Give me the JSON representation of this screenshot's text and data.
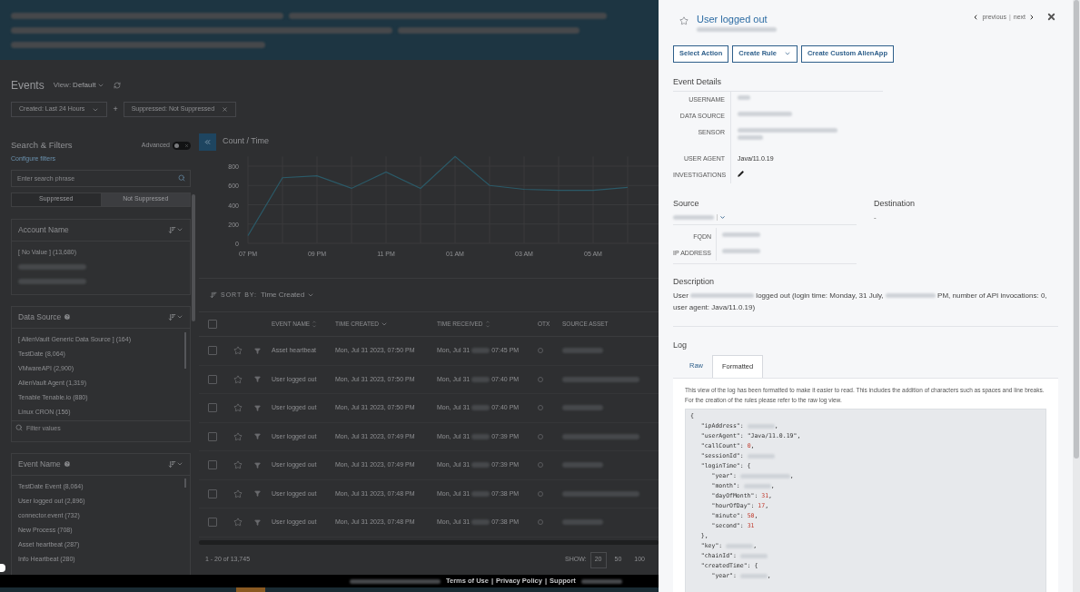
{
  "page": {
    "title": "Events",
    "view_label": "View:",
    "view_value": "Default",
    "filters": [
      {
        "label": "Created: Last 24 Hours",
        "kind": "dropdown"
      },
      {
        "label": "Suppressed: Not Suppressed",
        "kind": "removable"
      }
    ],
    "add_filter": "+"
  },
  "sidebar": {
    "title": "Search & Filters",
    "advanced": {
      "label": "Advanced",
      "on": false
    },
    "configure_link": "Configure filters",
    "search": {
      "placeholder": "Enter search phrase"
    },
    "segments": [
      {
        "label": "Suppressed",
        "selected": false
      },
      {
        "label": "Not Suppressed",
        "selected": true
      }
    ],
    "facets": [
      {
        "title": "Account Name",
        "help": false,
        "items": [
          {
            "kind": "text",
            "label": "[ No Value ] (13,680)"
          },
          {
            "kind": "redacted"
          },
          {
            "kind": "redacted"
          }
        ]
      },
      {
        "title": "Data Source",
        "help": true,
        "filter": {
          "placeholder": "Filter values"
        },
        "items": [
          {
            "kind": "text",
            "label": "[ AlienVault Generic Data Source ] (164)"
          },
          {
            "kind": "text",
            "label": "TestDate (8,064)"
          },
          {
            "kind": "text",
            "label": "VMwareAPI (2,900)"
          },
          {
            "kind": "text",
            "label": "AlienVault Agent (1,319)"
          },
          {
            "kind": "text",
            "label": "Tenable Tenable.io (880)"
          },
          {
            "kind": "text",
            "label": "Linux CRON (156)"
          }
        ]
      },
      {
        "title": "Event Name",
        "help": true,
        "items": [
          {
            "kind": "text",
            "label": "TestDate Event (8,064)"
          },
          {
            "kind": "text",
            "label": "User logged out (2,896)"
          },
          {
            "kind": "text",
            "label": "connector.event (732)"
          },
          {
            "kind": "text",
            "label": "New Process (708)"
          },
          {
            "kind": "text",
            "label": "Asset heartbeat (287)"
          },
          {
            "kind": "text",
            "label": "Info Heartbeat (280)"
          }
        ]
      }
    ]
  },
  "chart": {
    "title": "Count / Time",
    "chart_data": {
      "type": "line",
      "categories": [
        "07 PM",
        null,
        "09 PM",
        null,
        "11 PM",
        null,
        "01 AM",
        null,
        "03 AM",
        null,
        "05 AM",
        null
      ],
      "series": [
        {
          "color": "#2b5a68",
          "values": [
            80,
            680,
            700,
            570,
            740,
            570,
            900,
            600,
            560,
            550,
            550,
            580
          ]
        }
      ],
      "ylim": [
        0,
        900
      ],
      "grid": true,
      "yticks": [
        0,
        200,
        400,
        600,
        800
      ]
    }
  },
  "table": {
    "sort_label": "SORT BY:",
    "sort_value": "Time Created",
    "select_all": {
      "checked": false
    },
    "columns": [
      {
        "label": "EVENT NAME",
        "kind": "sortable"
      },
      {
        "label": "TIME CREATED",
        "kind": "sorted"
      },
      {
        "label": "TIME RECEIVED",
        "kind": "sortable"
      },
      {
        "label": "OTX",
        "kind": "plain"
      },
      {
        "label": "SOURCE ASSET",
        "kind": "plain"
      }
    ],
    "rows": [
      {
        "checked": false,
        "starred": false,
        "event": "Asset heartbeat",
        "created": "Mon, Jul 31 2023, 07:50 PM",
        "received_date": "Mon, Jul 31",
        "received_time": "07:45 PM"
      },
      {
        "checked": false,
        "starred": false,
        "event": "User logged out",
        "created": "Mon, Jul 31 2023, 07:50 PM",
        "received_date": "Mon, Jul 31",
        "received_time": "07:40 PM"
      },
      {
        "checked": false,
        "starred": false,
        "event": "User logged out",
        "created": "Mon, Jul 31 2023, 07:50 PM",
        "received_date": "Mon, Jul 31",
        "received_time": "07:40 PM"
      },
      {
        "checked": false,
        "starred": false,
        "event": "User logged out",
        "created": "Mon, Jul 31 2023, 07:49 PM",
        "received_date": "Mon, Jul 31",
        "received_time": "07:39 PM"
      },
      {
        "checked": false,
        "starred": false,
        "event": "User logged out",
        "created": "Mon, Jul 31 2023, 07:49 PM",
        "received_date": "Mon, Jul 31",
        "received_time": "07:39 PM"
      },
      {
        "checked": false,
        "starred": false,
        "event": "User logged out",
        "created": "Mon, Jul 31 2023, 07:48 PM",
        "received_date": "Mon, Jul 31",
        "received_time": "07:38 PM"
      },
      {
        "checked": false,
        "starred": false,
        "event": "User logged out",
        "created": "Mon, Jul 31 2023, 07:48 PM",
        "received_date": "Mon, Jul 31",
        "received_time": "07:38 PM"
      }
    ],
    "pagination": {
      "range": "1 - 20 of 13,745",
      "show_label": "SHOW:",
      "sizes": [
        {
          "label": "20",
          "selected": true
        },
        {
          "label": "50",
          "selected": false
        },
        {
          "label": "100",
          "selected": false
        }
      ]
    }
  },
  "footer": {
    "links": [
      "Terms of Use",
      "Privacy Policy",
      "Support"
    ],
    "separator": "|"
  },
  "detail": {
    "title": "User logged out",
    "starred": false,
    "nav": {
      "previous": "previous",
      "separator": "|",
      "next": "next"
    },
    "actions": [
      {
        "label": "Select Action",
        "kind": "button"
      },
      {
        "label": "Create Rule",
        "kind": "dropdown"
      },
      {
        "label": "Create Custom AlienApp",
        "kind": "button"
      }
    ],
    "event_details": {
      "heading": "Event Details",
      "fields": [
        {
          "label": "USERNAME",
          "kind": "redacted"
        },
        {
          "label": "DATA SOURCE",
          "kind": "redacted"
        },
        {
          "label": "SENSOR",
          "kind": "redacted_multiline"
        },
        {
          "label": "USER AGENT",
          "kind": "text",
          "value": "Java/11.0.19"
        },
        {
          "label": "INVESTIGATIONS",
          "kind": "edit"
        }
      ]
    },
    "source": {
      "heading": "Source",
      "fields": [
        {
          "label": "FQDN"
        },
        {
          "label": "IP ADDRESS"
        }
      ]
    },
    "destination": {
      "heading": "Destination",
      "value": "-"
    },
    "description": {
      "heading": "Description",
      "parts": [
        "User",
        "logged out (login time: Monday, 31 July,",
        "PM, number of API invocations: 0, user agent: Java/11.0.19)"
      ]
    },
    "log": {
      "heading": "Log",
      "tabs": [
        {
          "label": "Raw",
          "selected": false
        },
        {
          "label": "Formatted",
          "selected": true
        }
      ],
      "note": "This view of the log has been formatted to make it easier to read. This includes the addition of characters such as spaces and line breaks. For the creation of the rules please refer to the raw log view.",
      "lines": [
        {
          "code": "{"
        },
        {
          "code": "   \"ipAddress\": ",
          "kind": "redacted",
          "tail": ","
        },
        {
          "code": "   \"userAgent\": ",
          "kind": "string",
          "value": "\"Java/11.0.19\"",
          "tail": ","
        },
        {
          "code": "   \"callCount\": ",
          "kind": "number",
          "value": "0",
          "tail": ","
        },
        {
          "code": "   \"sessionId\": ",
          "kind": "redacted"
        },
        {
          "code": "   \"loginTime\": {"
        },
        {
          "code": "      \"year\": ",
          "kind": "redacted",
          "tail": ","
        },
        {
          "code": "      \"month\": ",
          "kind": "redacted",
          "tail": ","
        },
        {
          "code": "      \"dayOfMonth\": ",
          "kind": "number",
          "value": "31",
          "tail": ","
        },
        {
          "code": "      \"hourOfDay\": ",
          "kind": "number",
          "value": "17",
          "tail": ","
        },
        {
          "code": "      \"minute\": ",
          "kind": "number",
          "value": "50",
          "tail": ","
        },
        {
          "code": "      \"second\": ",
          "kind": "number",
          "value": "31"
        },
        {
          "code": "   },"
        },
        {
          "code": "   \"key\": ",
          "kind": "redacted",
          "tail": ","
        },
        {
          "code": "   \"chainId\": ",
          "kind": "redacted"
        },
        {
          "code": "   \"createdTime\": {"
        },
        {
          "code": "      \"year\": ",
          "kind": "redacted",
          "tail": ","
        }
      ]
    }
  }
}
